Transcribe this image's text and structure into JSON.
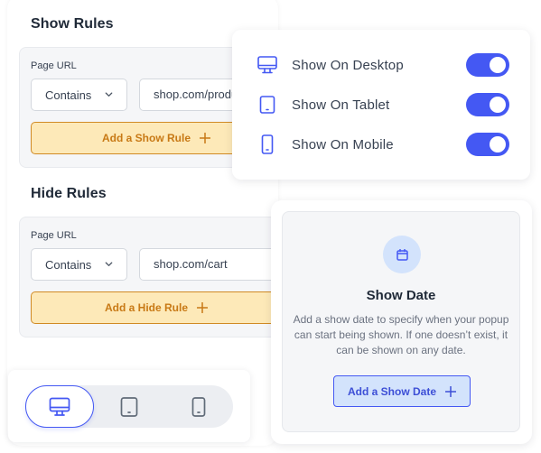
{
  "show_rules": {
    "title": "Show Rules",
    "field_label": "Page URL",
    "operator": "Contains",
    "url_value": "shop.com/products",
    "add_button": "Add a Show Rule"
  },
  "hide_rules": {
    "title": "Hide Rules",
    "field_label": "Page URL",
    "operator": "Contains",
    "url_value": "shop.com/cart",
    "add_button": "Add a Hide Rule"
  },
  "devices": {
    "items": [
      {
        "label": "Show On Desktop",
        "icon": "desktop-icon",
        "enabled": true
      },
      {
        "label": "Show On Tablet",
        "icon": "tablet-icon",
        "enabled": true
      },
      {
        "label": "Show On Mobile",
        "icon": "mobile-icon",
        "enabled": true
      }
    ]
  },
  "show_date": {
    "icon": "calendar-icon",
    "title": "Show Date",
    "description": "Add a show date to specify when your popup can start being shown. If one doesn’t exist, it can be shown on any date.",
    "add_button": "Add a Show Date"
  },
  "device_switcher": {
    "options": [
      "desktop",
      "tablet",
      "mobile"
    ],
    "selected": "desktop"
  },
  "colors": {
    "accent": "#4458f3",
    "rule_button_bg": "#fde9b8",
    "rule_button_text": "#c87915",
    "date_button_bg": "#d3e3fc"
  }
}
